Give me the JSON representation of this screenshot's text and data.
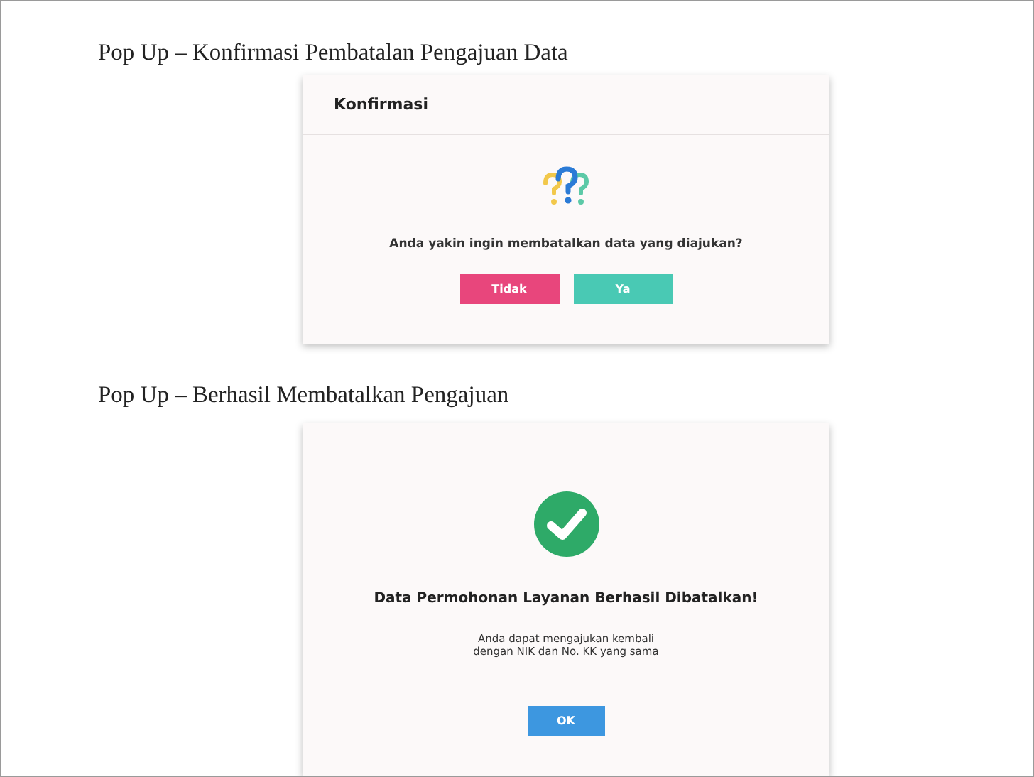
{
  "sections": [
    {
      "caption": "Pop Up – Konfirmasi Pembatalan Pengajuan Data",
      "dialog": {
        "title": "Konfirmasi",
        "kind": "question",
        "message": "Anda yakin ingin membatalkan data yang diajukan?",
        "buttons": [
          {
            "label": "Tidak",
            "kind": "danger"
          },
          {
            "label": "Ya",
            "kind": "success"
          }
        ]
      }
    },
    {
      "caption": "Pop Up – Berhasil Membatalkan Pengajuan",
      "dialog": {
        "kind": "success",
        "heading": "Data Permohonan Layanan Berhasil Dibatalkan!",
        "message": "Anda dapat mengajukan kembali dengan NIK dan No. KK yang sama",
        "buttons": [
          {
            "label": "OK",
            "kind": "primary"
          }
        ]
      }
    }
  ]
}
